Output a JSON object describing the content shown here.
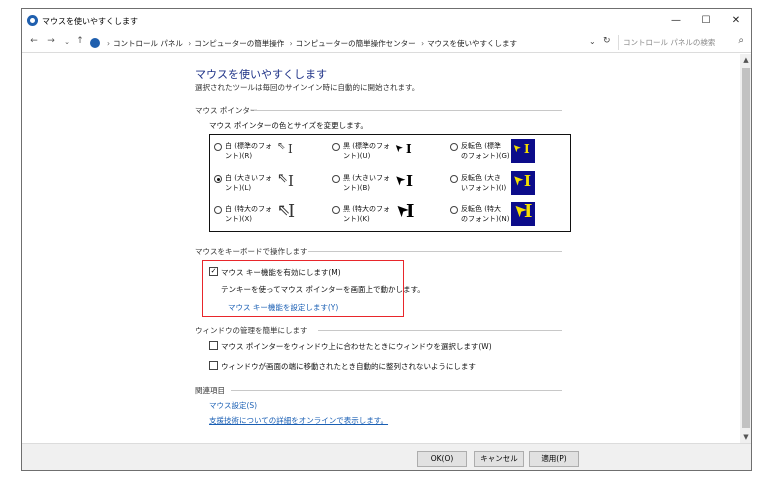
{
  "window": {
    "title": "マウスを使いやすくします"
  },
  "address": {
    "crumbs": [
      "コントロール パネル",
      "コンピューターの簡単操作",
      "コンピューターの簡単操作センター",
      "マウスを使いやすくします"
    ],
    "search_placeholder": "コントロール パネルの検索"
  },
  "page": {
    "title": "マウスを使いやすくします",
    "subtitle": "選択されたツールは毎回のサインイン時に自動的に開始されます。"
  },
  "pointer_section": {
    "heading": "マウス ポインター",
    "desc": "マウス ポインターの色とサイズを変更します。",
    "options": [
      {
        "label": "白 (標準のフォント)(R)",
        "line1": "白 (標準のフォ",
        "line2": "ント)(R)",
        "checked": false,
        "style": "white",
        "size": "small"
      },
      {
        "label": "黒 (標準のフォント)(U)",
        "line1": "黒 (標準のフォ",
        "line2": "ント)(U)",
        "checked": false,
        "style": "black",
        "size": "small"
      },
      {
        "label": "反転色 (標準のフォント)(G)",
        "line1": "反転色 (標準",
        "line2": "のフォント)(G)",
        "checked": false,
        "style": "inverted",
        "size": "small"
      },
      {
        "label": "白 (大きいフォント)(L)",
        "line1": "白 (大きいフォ",
        "line2": "ント)(L)",
        "checked": true,
        "style": "white",
        "size": "medium"
      },
      {
        "label": "黒 (大きいフォント)(B)",
        "line1": "黒 (大きいフォ",
        "line2": "ント)(B)",
        "checked": false,
        "style": "black",
        "size": "medium"
      },
      {
        "label": "反転色 (大きいフォント)(I)",
        "line1": "反転色 (大き",
        "line2": "いフォント)(I)",
        "checked": false,
        "style": "inverted",
        "size": "medium"
      },
      {
        "label": "白 (特大のフォント)(X)",
        "line1": "白 (特大のフォ",
        "line2": "ント)(X)",
        "checked": false,
        "style": "white",
        "size": "large"
      },
      {
        "label": "黒 (特大のフォント)(K)",
        "line1": "黒 (特大のフォ",
        "line2": "ント)(K)",
        "checked": false,
        "style": "black",
        "size": "large"
      },
      {
        "label": "反転色 (特大のフォント)(N)",
        "line1": "反転色 (特大",
        "line2": "のフォント)(N)",
        "checked": false,
        "style": "inverted",
        "size": "large"
      }
    ]
  },
  "keyboard_section": {
    "heading": "マウスをキーボードで操作します",
    "mousekeys_label": "マウス キー機能を有効にします(M)",
    "mousekeys_checked": true,
    "mousekeys_desc": "テンキーを使ってマウス ポインターを画面上で動かします。",
    "setup_link": "マウス キー機能を設定します(Y)"
  },
  "window_section": {
    "heading": "ウィンドウの管理を簡単にします",
    "option1": "マウス ポインターをウィンドウ上に合わせたときにウィンドウを選択します(W)",
    "option2": "ウィンドウが画面の端に移動されたとき自動的に整列されないようにします"
  },
  "related_section": {
    "heading": "関連項目",
    "link1": "マウス設定(S)",
    "link2": "支援技術についての詳細をオンラインで表示します。"
  },
  "footer": {
    "ok": "OK(O)",
    "cancel": "キャンセル",
    "apply": "適用(P)"
  },
  "colors": {
    "title": "#1e3287",
    "link": "#1a5fb4",
    "highlight_border": "#e8262b",
    "inverted_bg": "#0c0c8a",
    "inverted_fg": "#f5e000"
  }
}
